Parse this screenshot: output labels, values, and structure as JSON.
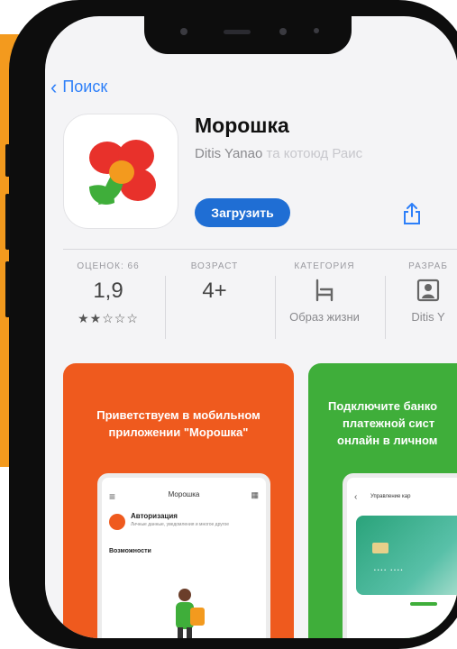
{
  "nav": {
    "back_label": "Поиск"
  },
  "app": {
    "title": "Морошка",
    "developer": "Ditis Yanao",
    "developer_faded": "та котоюд Раис",
    "get_label": "Загрузить"
  },
  "stats": [
    {
      "label": "ОЦЕНОК: 66",
      "value": "1,9",
      "stars": "★★☆☆☆",
      "rating": 1.9
    },
    {
      "label": "ВОЗРАСТ",
      "value": "4+"
    },
    {
      "label": "КАТЕГОРИЯ",
      "sub": "Образ жизни"
    },
    {
      "label": "РАЗРАБ",
      "sub": "Ditis Y"
    }
  ],
  "screenshots": [
    {
      "text1": "Приветствуем в мобильном",
      "text2": "приложении \"Морошка\"",
      "color": "#ef5a1e",
      "mini_title": "Морошка",
      "mini_auth": "Авторизация",
      "mini_auth_desc": "Личные данные, уведомления и многое другое",
      "mini_section": "Возможности"
    },
    {
      "text1": "Подключите банко",
      "text2": "платежной сист",
      "text3": "онлайн в личном",
      "color": "#3fae3a",
      "mini_title": "Управление кар"
    }
  ],
  "colors": {
    "accent": "#1f6ed4",
    "orange": "#f39a1e",
    "logo_red": "#e8312b",
    "logo_orange": "#f39a1e",
    "logo_green": "#3fae3a"
  }
}
